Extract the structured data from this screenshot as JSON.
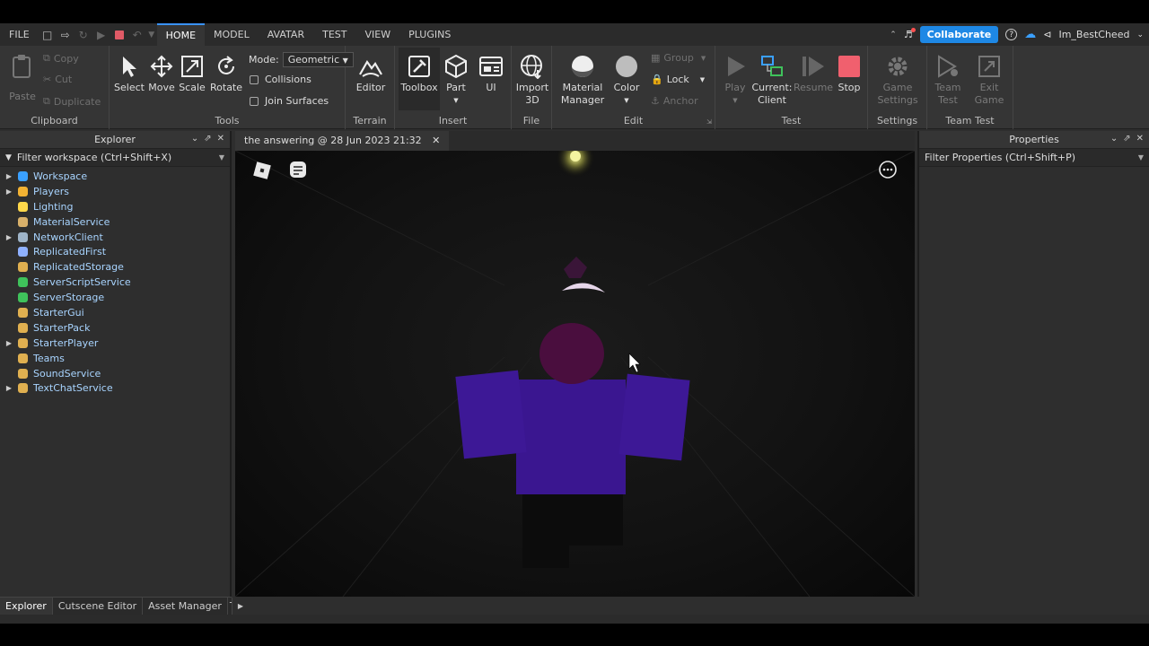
{
  "menubar": {
    "items": [
      "FILE",
      "HOME",
      "MODEL",
      "AVATAR",
      "TEST",
      "VIEW",
      "PLUGINS"
    ],
    "active": "HOME",
    "collaborate_label": "Collaborate",
    "username": "Im_BestCheed"
  },
  "ribbon": {
    "clipboard": {
      "label": "Clipboard",
      "paste": "Paste",
      "copy": "Copy",
      "cut": "Cut",
      "duplicate": "Duplicate"
    },
    "tools": {
      "label": "Tools",
      "select": "Select",
      "move": "Move",
      "scale": "Scale",
      "rotate": "Rotate",
      "mode_label": "Mode:",
      "mode_value": "Geometric",
      "collisions": "Collisions",
      "join_surfaces": "Join Surfaces"
    },
    "terrain": {
      "label": "Terrain",
      "editor": "Editor"
    },
    "insert": {
      "label": "Insert",
      "toolbox": "Toolbox",
      "part": "Part",
      "ui": "UI"
    },
    "file": {
      "label": "File",
      "import_line1": "Import",
      "import_line2": "3D"
    },
    "edit": {
      "label": "Edit",
      "material_line1": "Material",
      "material_line2": "Manager",
      "color": "Color",
      "group": "Group",
      "lock": "Lock",
      "anchor": "Anchor"
    },
    "test": {
      "label": "Test",
      "play": "Play",
      "current_line1": "Current:",
      "current_line2": "Client",
      "resume": "Resume",
      "stop": "Stop"
    },
    "settings": {
      "label": "Settings",
      "game_line1": "Game",
      "game_line2": "Settings"
    },
    "team_test": {
      "label": "Team Test",
      "team_line1": "Team",
      "team_line2": "Test",
      "exit_line1": "Exit",
      "exit_line2": "Game"
    }
  },
  "explorer": {
    "title": "Explorer",
    "filter_placeholder": "Filter workspace (Ctrl+Shift+X)",
    "items": [
      {
        "label": "Workspace",
        "expandable": true,
        "icon": "globe-icon",
        "color": "#3aa0ff"
      },
      {
        "label": "Players",
        "expandable": true,
        "icon": "players-icon",
        "color": "#f2b233"
      },
      {
        "label": "Lighting",
        "expandable": false,
        "icon": "bulb-icon",
        "color": "#ffd84a"
      },
      {
        "label": "MaterialService",
        "expandable": false,
        "icon": "material-icon",
        "color": "#d8b06a"
      },
      {
        "label": "NetworkClient",
        "expandable": true,
        "icon": "network-icon",
        "color": "#9fb4c8"
      },
      {
        "label": "ReplicatedFirst",
        "expandable": false,
        "icon": "replicated-first-icon",
        "color": "#8fb1ff"
      },
      {
        "label": "ReplicatedStorage",
        "expandable": false,
        "icon": "replicated-storage-icon",
        "color": "#e0b050"
      },
      {
        "label": "ServerScriptService",
        "expandable": false,
        "icon": "server-script-icon",
        "color": "#3fc25b"
      },
      {
        "label": "ServerStorage",
        "expandable": false,
        "icon": "server-storage-icon",
        "color": "#3fc25b"
      },
      {
        "label": "StarterGui",
        "expandable": false,
        "icon": "starter-gui-icon",
        "color": "#e0b050"
      },
      {
        "label": "StarterPack",
        "expandable": false,
        "icon": "starter-pack-icon",
        "color": "#e0b050"
      },
      {
        "label": "StarterPlayer",
        "expandable": true,
        "icon": "starter-player-icon",
        "color": "#e0b050"
      },
      {
        "label": "Teams",
        "expandable": false,
        "icon": "teams-icon",
        "color": "#e0b050"
      },
      {
        "label": "SoundService",
        "expandable": false,
        "icon": "sound-icon",
        "color": "#e0b050"
      },
      {
        "label": "TextChatService",
        "expandable": true,
        "icon": "chat-icon",
        "color": "#e0b050"
      }
    ],
    "bottom_tabs": [
      "Explorer",
      "Cutscene Editor",
      "Asset Manager",
      "To"
    ]
  },
  "document": {
    "tab_label": "the answering @ 28 Jun 2023 21:32"
  },
  "properties": {
    "title": "Properties",
    "filter_placeholder": "Filter Properties (Ctrl+Shift+P)"
  },
  "colors": {
    "accent": "#1e88e5",
    "stop": "#f0606e",
    "tree_text": "#a8d4ff"
  }
}
